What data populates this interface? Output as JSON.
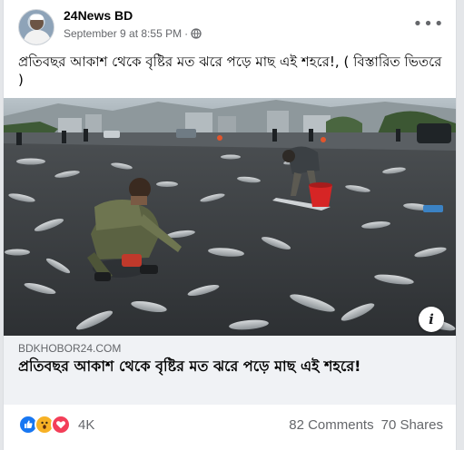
{
  "post": {
    "page_name": "24News BD",
    "timestamp": "September 9 at 8:55 PM",
    "separator": "·",
    "audience_icon": "globe-icon",
    "more_label": "•••",
    "text": "প্রতিবছর আকাশ থেকে বৃষ্টির মত ঝরে পড়ে মাছ এই শহরে!, ( বিস্তারিত ভিতরে )"
  },
  "link": {
    "domain": "BDKHOBOR24.COM",
    "title": "প্রতিবছর আকাশ থেকে বৃষ্টির মত ঝরে পড়ে মাছ এই শহরে!",
    "info_label": "i"
  },
  "engagement": {
    "reaction_icons": [
      "like-icon",
      "wow-icon",
      "love-icon"
    ],
    "reaction_count": "4K",
    "comments": "82 Comments",
    "shares": "70 Shares"
  },
  "colors": {
    "like": "#1877f2",
    "wow": "#f7b125",
    "love": "#f33e58",
    "secondary_text": "#65676b",
    "link_bg": "#f0f2f5"
  }
}
